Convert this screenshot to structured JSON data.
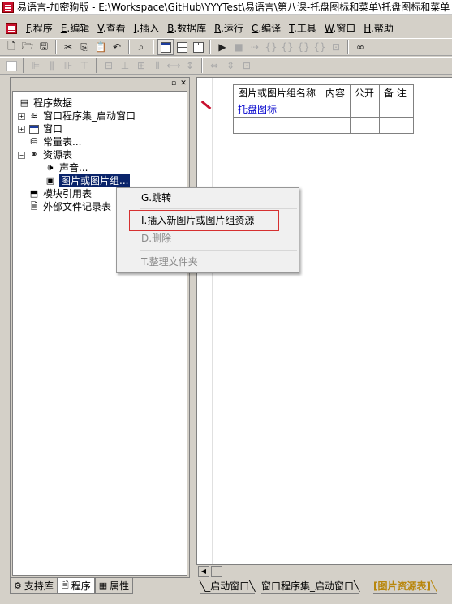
{
  "window": {
    "title": "易语言-加密狗版 - E:\\Workspace\\GitHub\\YYYTest\\易语言\\第八课-托盘图标和菜单\\托盘图标和菜单"
  },
  "menu": {
    "items": [
      {
        "hotkey": "F",
        "label": ".程序"
      },
      {
        "hotkey": "E",
        "label": ".编辑"
      },
      {
        "hotkey": "V",
        "label": ".查看"
      },
      {
        "hotkey": "I",
        "label": ".插入"
      },
      {
        "hotkey": "B",
        "label": ".数据库"
      },
      {
        "hotkey": "R",
        "label": ".运行"
      },
      {
        "hotkey": "C",
        "label": ".编译"
      },
      {
        "hotkey": "T",
        "label": ".工具"
      },
      {
        "hotkey": "W",
        "label": ".窗口"
      },
      {
        "hotkey": "H",
        "label": ".帮助"
      }
    ]
  },
  "toolbar": {
    "row1": [
      "new-file-icon",
      "open-folder-icon",
      "save-icon",
      "cut-icon",
      "copy-icon",
      "paste-icon",
      "undo-icon",
      "find-icon",
      "window-layout-icon",
      "split-horizontal-icon",
      "split-columns-icon",
      "run-icon",
      "stop-icon",
      "step-icon",
      "step-into-icon",
      "step-over-icon",
      "step-out-icon",
      "run-to-cursor-icon",
      "breakpoint-icon",
      "binoculars-icon"
    ],
    "row2": [
      "align-left-icon",
      "align-center-icon",
      "align-right-icon",
      "align-top-icon",
      "align-middle-icon",
      "align-bottom-icon",
      "same-width-icon",
      "same-height-icon",
      "space-horizontal-icon",
      "space-vertical-icon"
    ]
  },
  "tree": {
    "root": "程序数据",
    "items": [
      {
        "label": "窗口程序集_启动窗口",
        "icon": "assembly-icon"
      },
      {
        "label": "窗口",
        "icon": "window-icon"
      },
      {
        "label": "常量表...",
        "icon": "constant-table-icon"
      },
      {
        "label": "资源表",
        "icon": "resource-table-icon"
      },
      {
        "label": "声音...",
        "icon": "sound-icon"
      },
      {
        "label": "图片或图片组...",
        "icon": "picture-icon"
      },
      {
        "label": "模块引用表",
        "icon": "module-icon"
      },
      {
        "label": "外部文件记录表",
        "icon": "file-record-icon"
      }
    ]
  },
  "left_tabs": [
    {
      "label": "支持库"
    },
    {
      "label": "程序"
    },
    {
      "label": "属性"
    }
  ],
  "resource_table": {
    "headers": [
      "图片或图片组名称",
      "内容",
      "公开",
      "备 注"
    ],
    "rows": [
      [
        "托盘图标",
        "",
        "",
        ""
      ],
      [
        "",
        "",
        "",
        ""
      ]
    ]
  },
  "editor_tabs": [
    {
      "label": "_启动窗口"
    },
    {
      "label": "窗口程序集_启动窗口"
    },
    {
      "label": "[图片资源表]"
    }
  ],
  "context_menu": {
    "items": [
      {
        "label": "G.跳转",
        "enabled": true
      },
      {
        "label": "I.插入新图片或图片组资源",
        "enabled": true
      },
      {
        "label": "D.删除",
        "enabled": false
      },
      {
        "label": "T.整理文件夹",
        "enabled": false
      }
    ]
  },
  "colors": {
    "selection": "#0a246a",
    "highlight_box": "#d63030",
    "active_tab_text": "#b8860b",
    "app_red": "#c8102e"
  }
}
